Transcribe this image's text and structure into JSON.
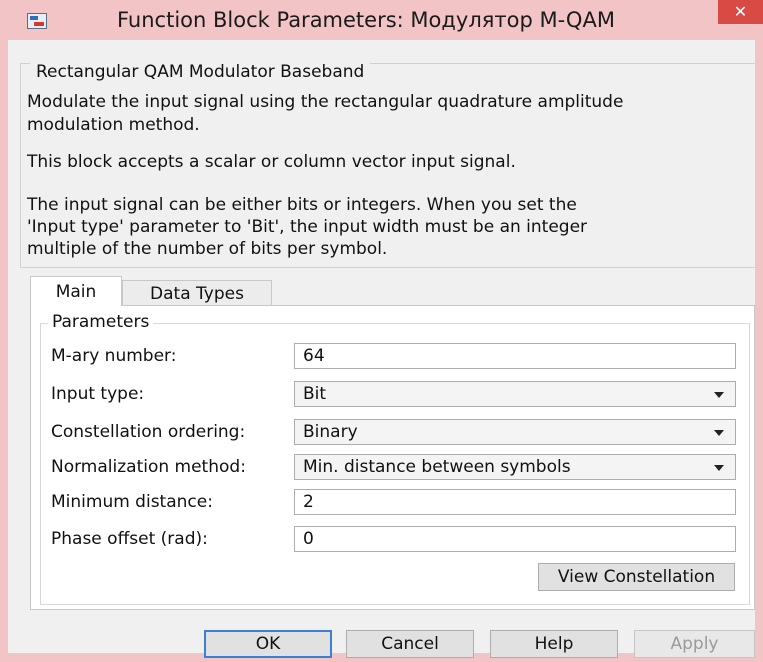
{
  "window": {
    "title": "Function Block Parameters: Модулятор M-QAM",
    "close_glyph": "✕"
  },
  "description": {
    "block_name": "Rectangular QAM Modulator Baseband",
    "lines": [
      "Modulate the input signal using the rectangular quadrature amplitude",
      "modulation method.",
      "This block accepts a scalar or column vector input signal.",
      "The input signal can be either bits or integers. When you set the",
      "'Input type' parameter to 'Bit', the input width must be an integer",
      "multiple of the number of bits per symbol."
    ]
  },
  "tabs": [
    {
      "label": "Main",
      "selected": true
    },
    {
      "label": "Data Types",
      "selected": false
    }
  ],
  "parameters": {
    "group_label": "Parameters",
    "m_ary_number": {
      "label": "M-ary number:",
      "value": "64"
    },
    "input_type": {
      "label": "Input type:",
      "value": "Bit"
    },
    "constellation_ordering": {
      "label": "Constellation ordering:",
      "value": "Binary"
    },
    "normalization_method": {
      "label": "Normalization method:",
      "value": "Min. distance between symbols"
    },
    "minimum_distance": {
      "label": "Minimum distance:",
      "value": "2"
    },
    "phase_offset": {
      "label": "Phase offset (rad):",
      "value": "0"
    },
    "view_constellation_label": "View Constellation"
  },
  "buttons": {
    "ok": "OK",
    "cancel": "Cancel",
    "help": "Help",
    "apply": "Apply"
  },
  "icons": {
    "app": "simulink-block-icon",
    "close": "close-icon",
    "dropdown": "chevron-down-icon"
  },
  "colors": {
    "title_bar": "#f2c4c6",
    "close_button": "#d94a45",
    "default_button_border": "#3c7fd6"
  }
}
